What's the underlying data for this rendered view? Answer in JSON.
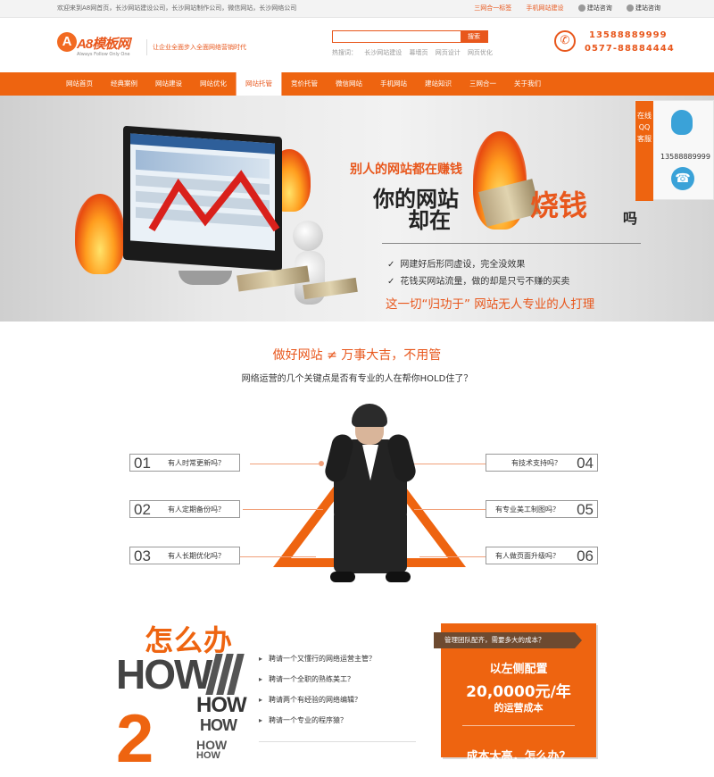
{
  "topbar": {
    "welcome": "欢迎来到A8网首页，长沙网站建设公司，长沙网站制作公司，微信网站，长沙网络公司",
    "links": [
      "三网合一标签",
      "手机网站建设",
      "建站咨询",
      "建站咨询"
    ]
  },
  "header": {
    "logo_mark": "A",
    "logo_name": "A8模板网",
    "logo_sub": "Always Follow Only One",
    "slogan": "让企业全面步入全面网络营销时代",
    "search_placeholder": "",
    "search_button": "搜索",
    "hot_label": "热搜词：",
    "hot_words": [
      "长沙网站建设",
      "幕墙页",
      "网页设计",
      "网页优化"
    ],
    "phone1": "13588889999",
    "phone2": "0577-88884444"
  },
  "nav": {
    "items": [
      "网站首页",
      "经典案例",
      "网站建设",
      "网站优化",
      "网站托管",
      "竞价托管",
      "微信网站",
      "手机网站",
      "建站知识",
      "三网合一",
      "关于我们"
    ],
    "active_index": 4
  },
  "banner": {
    "line1": "别人的网站都在赚钱",
    "line2": "你的网站",
    "line3": "却在",
    "highlight": "烧钱",
    "tail": "吗",
    "bullet1": "网建好后形同虚设，完全没效果",
    "bullet2": "花钱买网站流量，做的却是只亏不赚的买卖",
    "slogan": "这一切“归功于”   网站无人专业的人打理"
  },
  "float_panel": {
    "tab_label": "在线QQ客服",
    "phone": "13588889999"
  },
  "section1": {
    "title": "做好网站  ≠  万事大吉，不用管",
    "subtitle": "网络运营的几个关键点是否有专业的人在帮你HOLD住了？",
    "questions": [
      {
        "num": "01",
        "text": "有人时常更新吗？"
      },
      {
        "num": "02",
        "text": "有人定期备份吗？"
      },
      {
        "num": "03",
        "text": "有人长期优化吗？"
      },
      {
        "num": "04",
        "text": "有技术支持吗？"
      },
      {
        "num": "05",
        "text": "有专业美工制图吗？"
      },
      {
        "num": "06",
        "text": "有人做页面升级吗？"
      }
    ]
  },
  "section2": {
    "cn_title": "怎么办",
    "how_big": "HOW",
    "how_medium": "HOW",
    "how_small": "HOW",
    "how_xs": "HOW",
    "how_xxs": "HOW",
    "big_number": "2",
    "list": [
      "聘请一个又懂行的网络运营主管？",
      "聘请一个全职的熟练美工？",
      "聘请两个有经验的网络编辑？",
      "聘请一个专业的程序猿？"
    ],
    "cost_badge": "管理团队配齐，需要多大的成本？",
    "cost_l1": "以左侧配置",
    "cost_l2": "20,0000元/年",
    "cost_l3": "的运营成本",
    "cost_l4": "成本太高，怎么办？"
  },
  "colors": {
    "accent": "#ee6410",
    "brown": "#6d4a30",
    "qq_blue": "#3aa2d8"
  }
}
